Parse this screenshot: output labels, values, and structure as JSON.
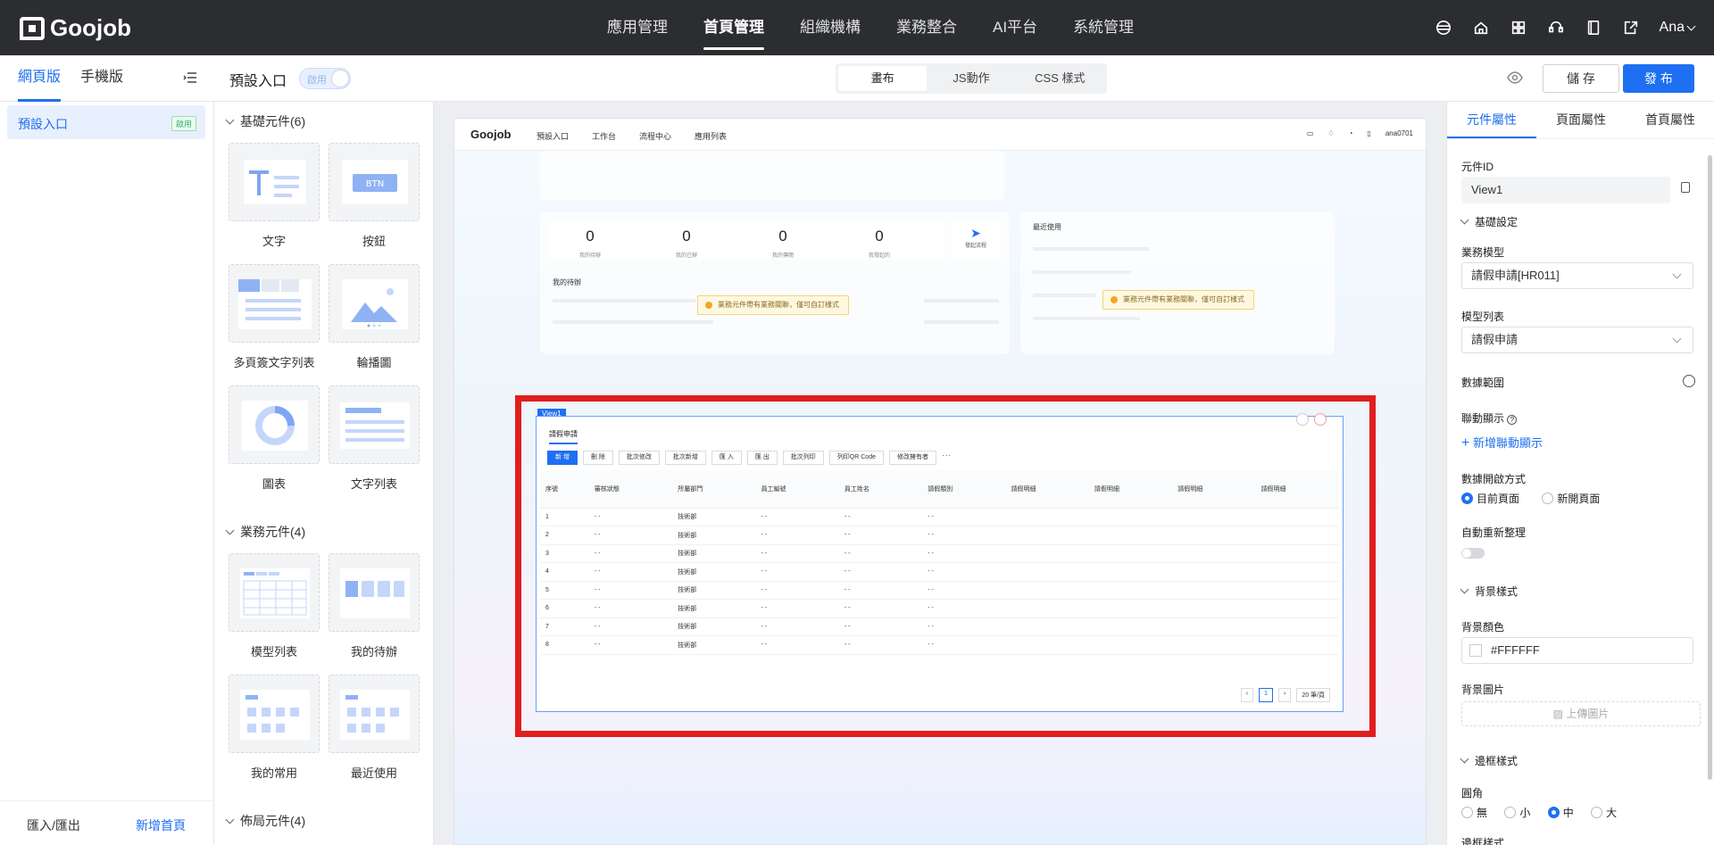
{
  "top_nav": {
    "logo": "Goojob",
    "items": [
      "應用管理",
      "首頁管理",
      "組織機構",
      "業務整合",
      "AI平台",
      "系統管理"
    ],
    "active_index": 1,
    "user": "Ana"
  },
  "toolbar": {
    "left_tabs": [
      "網頁版",
      "手機版"
    ],
    "entry_title": "預設入口",
    "toggle_label": "啟用",
    "segments": [
      "畫布",
      "JS動作",
      "CSS 樣式"
    ],
    "save_label": "儲 存",
    "publish_label": "發 布"
  },
  "sidebar": {
    "item_label": "預設入口",
    "item_badge": "啟用",
    "footer_import": "匯入/匯出",
    "footer_new": "新增首頁"
  },
  "palette": {
    "basic_title": "基礎元件(6)",
    "basic": [
      "文字",
      "按鈕",
      "多頁簽文字列表",
      "輪播圖",
      "圖表",
      "文字列表"
    ],
    "btn_text": "BTN",
    "business_title": "業務元件(4)",
    "business": [
      "模型列表",
      "我的待辦",
      "我的常用",
      "最近使用"
    ],
    "layout_title": "佈局元件(4)"
  },
  "canvas": {
    "header": {
      "logo": "Goojob",
      "nav": [
        "預設入口",
        "工作台",
        "流程中心",
        "應用列表"
      ],
      "user": "ana0701"
    },
    "stats": [
      {
        "value": "0",
        "label": "我的待辦"
      },
      {
        "value": "0",
        "label": "我的已辦"
      },
      {
        "value": "0",
        "label": "我的傳閱"
      },
      {
        "value": "0",
        "label": "我發起的"
      }
    ],
    "start_flow": "發起流程",
    "my_todo": "我的待辦",
    "recent": "最近使用",
    "tip": "業務元件帶有業務關聯，僅可自訂樣式",
    "view_tag": "View1",
    "view_title": "請假申請",
    "view_buttons": [
      "新 增",
      "刪 除",
      "批次修改",
      "批次新增",
      "匯 入",
      "匯 出",
      "批次列印",
      "列印QR Code",
      "修改擁有者"
    ],
    "view_columns": [
      "序號",
      "審核狀態",
      "所屬部門",
      "員工編號",
      "員工姓名",
      "請假類別",
      "請假明細",
      "請假明細",
      "請假明細",
      "請假明細"
    ],
    "view_rows": [
      [
        "1",
        "- -",
        "技術部",
        "- -",
        "- -",
        "- -"
      ],
      [
        "2",
        "- -",
        "技術部",
        "- -",
        "- -",
        "- -"
      ],
      [
        "3",
        "- -",
        "技術部",
        "- -",
        "- -",
        "- -"
      ],
      [
        "4",
        "- -",
        "技術部",
        "- -",
        "- -",
        "- -"
      ],
      [
        "5",
        "- -",
        "技術部",
        "- -",
        "- -",
        "- -"
      ],
      [
        "6",
        "- -",
        "技術部",
        "- -",
        "- -",
        "- -"
      ],
      [
        "7",
        "- -",
        "技術部",
        "- -",
        "- -",
        "- -"
      ],
      [
        "8",
        "- -",
        "技術部",
        "- -",
        "- -",
        "- -"
      ]
    ],
    "page": "1",
    "page_size": "20 筆/頁"
  },
  "props": {
    "tabs": [
      "元件屬性",
      "頁面屬性",
      "首頁屬性"
    ],
    "component_id_label": "元件ID",
    "component_id": "View1",
    "basic_section": "基礎設定",
    "model_label": "業務模型",
    "model_value": "請假申請[HR011]",
    "list_label": "模型列表",
    "list_value": "請假申請",
    "data_range": "數據範圍",
    "linked_display": "聯動顯示",
    "add_linked": "新增聯動顯示",
    "open_mode_label": "數據開啟方式",
    "open_current": "目前頁面",
    "open_new": "新開頁面",
    "auto_refresh": "自動重新整理",
    "bg_section": "背景樣式",
    "bg_color_label": "背景顏色",
    "bg_color": "#FFFFFF",
    "bg_image_label": "背景圖片",
    "upload": "上傳圖片",
    "border_section": "邊框樣式",
    "radius_label": "圓角",
    "radius_options": [
      "無",
      "小",
      "中",
      "大"
    ],
    "border_style_label": "邊框樣式"
  },
  "colors": {
    "accent": "#1e6ff1",
    "topbar": "#2b2d31",
    "highlight": "#e01e1e"
  }
}
